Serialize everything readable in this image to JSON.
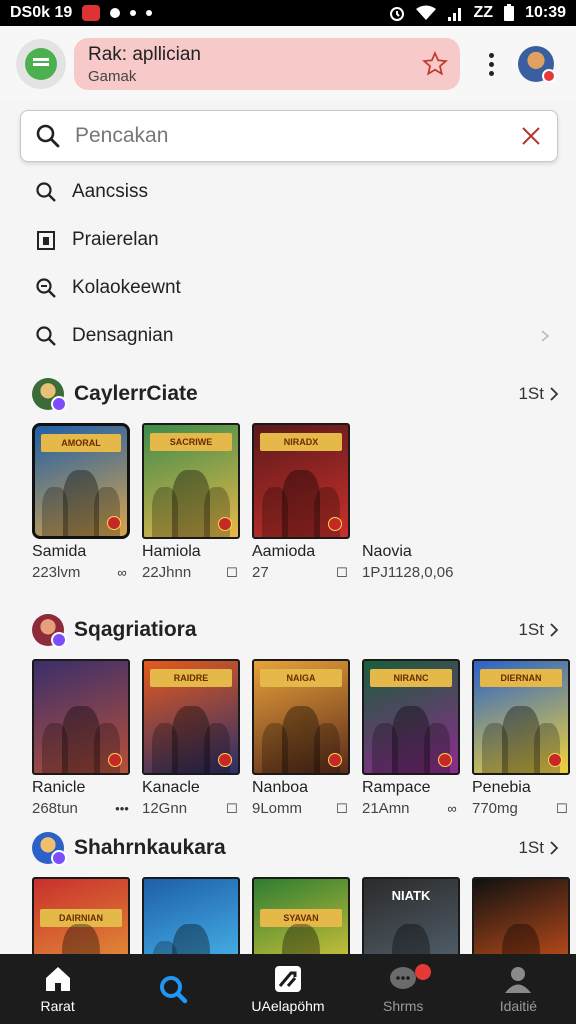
{
  "status_bar": {
    "left_text": "DS0k 19",
    "time": "10:39",
    "net_label": "ZZ"
  },
  "app_bar": {
    "title": "Rak: apllician",
    "subtitle": "Gamak"
  },
  "search": {
    "placeholder": "Pencakan",
    "value": ""
  },
  "suggestions": [
    {
      "label": "Aancsiss",
      "icon": "search-icon"
    },
    {
      "label": "Praierelan",
      "icon": "bookmark-icon"
    },
    {
      "label": "Kolaokeewnt",
      "icon": "zoom-search-icon"
    },
    {
      "label": "Densagnian",
      "icon": "search-icon"
    }
  ],
  "sections": [
    {
      "title": "CaylerrCiate",
      "more": "1St",
      "items": [
        {
          "name": "Samida",
          "meta": "223lvm",
          "banner": "AMORAL",
          "colors": [
            "#1e5fa8",
            "#d9a54a"
          ]
        },
        {
          "name": "Hamiola",
          "meta": "22Jhnn",
          "banner": "SACRIWE",
          "colors": [
            "#3c8c4a",
            "#e8b84a"
          ]
        },
        {
          "name": "Aamioda",
          "meta": "27",
          "banner": "NIRADX",
          "colors": [
            "#5a1a1a",
            "#c9302c"
          ]
        },
        {
          "name": "Naovia",
          "meta": "1PJ1128,0,06"
        }
      ]
    },
    {
      "title": "Sqagriatiora",
      "more": "1St",
      "items": [
        {
          "name": "Ranicle",
          "meta": "268tun",
          "banner": "",
          "colors": [
            "#3a2f6b",
            "#b7503a"
          ]
        },
        {
          "name": "Kanacle",
          "meta": "12Gnn",
          "banner": "RAIDRE",
          "colors": [
            "#e55a1c",
            "#2b2f6b"
          ]
        },
        {
          "name": "Nanboa",
          "meta": "9Lomm",
          "banner": "NAIGA",
          "colors": [
            "#e8a13a",
            "#5b2b1a"
          ]
        },
        {
          "name": "Rampace",
          "meta": "21Amn",
          "banner": "NIRANC",
          "colors": [
            "#1a5e3a",
            "#8e2b8e"
          ]
        },
        {
          "name": "Penebia",
          "meta": "770mg",
          "banner": "DIERNAN",
          "colors": [
            "#2a62c9",
            "#f2d23a"
          ]
        }
      ]
    },
    {
      "title": "Shahrnkaukara",
      "more": "1St",
      "items": [
        {
          "banner": "DAIRNIAN",
          "colors": [
            "#c9302c",
            "#e8a13a"
          ]
        },
        {
          "banner": "",
          "colors": [
            "#1e5fa8",
            "#4fc3f7"
          ]
        },
        {
          "banner": "SYAVAN",
          "colors": [
            "#2e7d32",
            "#f2d23a"
          ]
        },
        {
          "banner": "NIATK",
          "colors": [
            "#2b2b2b",
            "#5a6b7a"
          ]
        },
        {
          "banner": "",
          "colors": [
            "#111111",
            "#e55a1c"
          ]
        }
      ]
    }
  ],
  "bottom_nav": [
    {
      "label": "Rarat",
      "icon": "home-icon",
      "active": true
    },
    {
      "label": "",
      "icon": "search-icon",
      "active": false
    },
    {
      "label": "UAelapöhm",
      "icon": "library-icon",
      "active": false
    },
    {
      "label": "Shrms",
      "icon": "chat-icon",
      "active": false,
      "badge": true
    },
    {
      "label": "Idaitié",
      "icon": "profile-icon",
      "active": false
    }
  ],
  "colors": {
    "accent": "#f7c9c9",
    "search_accent": "#2196f3",
    "alert": "#e53935"
  }
}
